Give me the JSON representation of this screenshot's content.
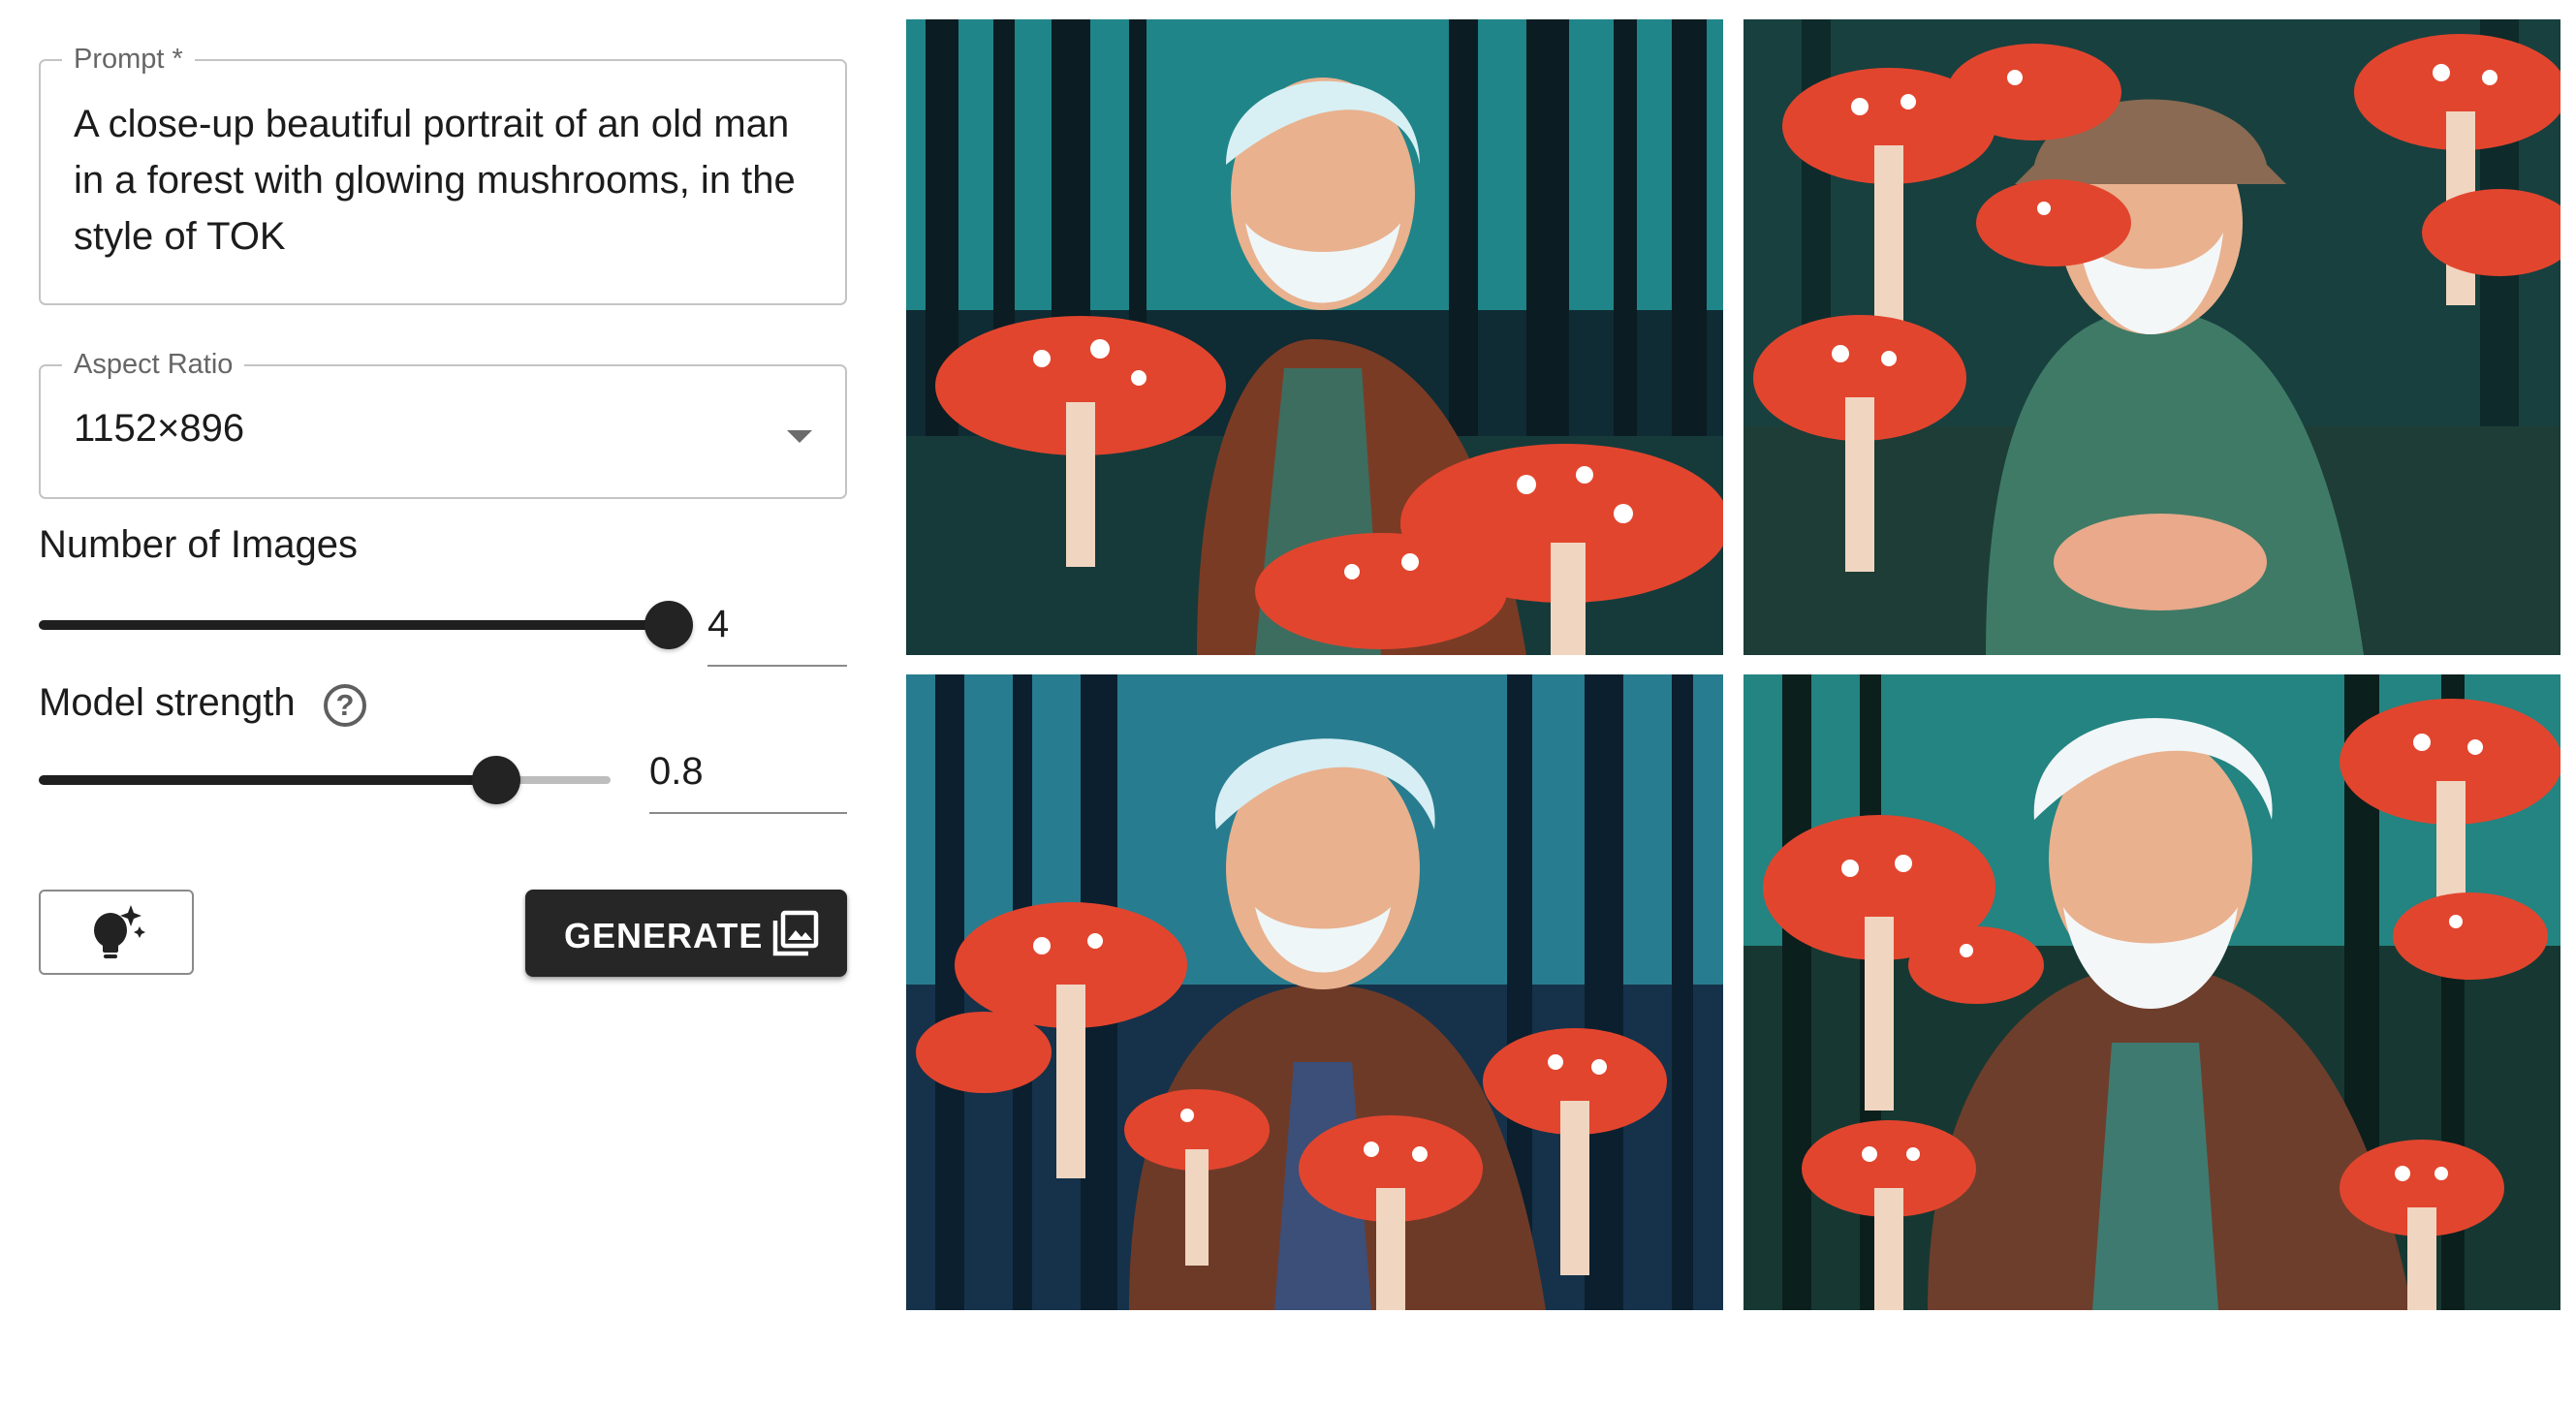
{
  "form": {
    "prompt": {
      "label": "Prompt *",
      "value": "A close-up beautiful portrait of an old man in a forest with glowing mushrooms, in the style of TOK"
    },
    "aspect_ratio": {
      "label": "Aspect Ratio",
      "value": "1152×896"
    },
    "num_images": {
      "label": "Number of Images",
      "value": "4",
      "fraction": 1.0
    },
    "model_strength": {
      "label": "Model strength",
      "value": "0.8",
      "fraction": 0.8,
      "help_icon": "question-circle-icon"
    },
    "idea_button": {
      "icon": "lightbulb-sparkle-icon"
    },
    "generate_button": {
      "label": "GENERATE",
      "icon": "image-collection-icon"
    }
  },
  "gallery": {
    "images": [
      {
        "name": "old-man-forest-mushrooms-1"
      },
      {
        "name": "old-man-forest-mushrooms-2"
      },
      {
        "name": "old-man-forest-mushrooms-3"
      },
      {
        "name": "old-man-forest-mushrooms-4"
      }
    ]
  },
  "colors": {
    "button_dark": "#262626",
    "slider_dark": "#1f1f1f",
    "mushroom_red": "#e2452e",
    "forest_teal": "#2fcfcf"
  }
}
